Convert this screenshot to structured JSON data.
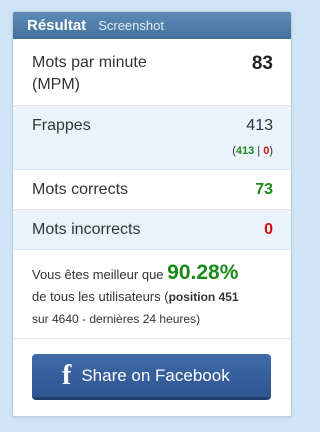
{
  "header": {
    "title": "Résultat",
    "subtitle": "Screenshot"
  },
  "stats": {
    "wpm": {
      "label": "Mots par minute (MPM)",
      "value": "83"
    },
    "keystrokes": {
      "label": "Frappes",
      "value": "413",
      "correct": "413",
      "separator": "|",
      "incorrect": "0"
    },
    "correct_words": {
      "label": "Mots corrects",
      "value": "73"
    },
    "incorrect_words": {
      "label": "Mots incorrects",
      "value": "0"
    }
  },
  "rank": {
    "prefix": "Vous êtes meilleur que",
    "percent": "90.28%",
    "middle": "de tous les utilisateurs (",
    "position": "position 451",
    "suffix": "sur 4640 - dernières 24 heures)"
  },
  "share": {
    "icon": "facebook-icon",
    "glyph": "f",
    "label": "Share on Facebook"
  },
  "colors": {
    "header": "#4d7da8",
    "good": "#1a8a1a",
    "bad": "#d11010",
    "facebook": "#3b5998"
  }
}
